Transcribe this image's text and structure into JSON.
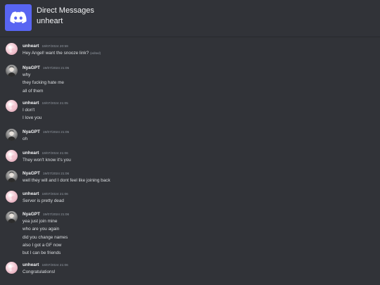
{
  "header": {
    "title": "Direct Messages",
    "subtitle": "unheart",
    "logo_icon": "discord-logo-icon",
    "logo_color": "#5865f2"
  },
  "messages": [
    {
      "author": "unheart",
      "timestamp": "19/07/2024 20:59",
      "avatar": "pink",
      "lines": [
        "Hey Angel! want the snooze link?"
      ],
      "edited_label": "(edited)"
    },
    {
      "author": "NyaGPT",
      "timestamp": "19/07/2024 21:05",
      "avatar": "gray",
      "lines": [
        "why",
        "they fucking hate me",
        "all of them"
      ]
    },
    {
      "author": "unheart",
      "timestamp": "19/07/2024 21:05",
      "avatar": "pink",
      "lines": [
        "I don't",
        "I love you"
      ]
    },
    {
      "author": "NyaGPT",
      "timestamp": "19/07/2024 21:05",
      "avatar": "gray",
      "lines": [
        "oh"
      ]
    },
    {
      "author": "unheart",
      "timestamp": "19/07/2024 21:06",
      "avatar": "pink",
      "lines": [
        "They won't know it's you"
      ]
    },
    {
      "author": "NyaGPT",
      "timestamp": "19/07/2024 21:06",
      "avatar": "gray",
      "lines": [
        "well they will and I dont feel like joining back"
      ]
    },
    {
      "author": "unheart",
      "timestamp": "19/07/2024 21:06",
      "avatar": "pink",
      "lines": [
        "Server is pretty dead"
      ]
    },
    {
      "author": "NyaGPT",
      "timestamp": "19/07/2024 21:06",
      "avatar": "gray",
      "lines": [
        "yea just join mine",
        "who are you again",
        "did you change names",
        "also I got a GF now",
        "but I can be friends"
      ]
    },
    {
      "author": "unheart",
      "timestamp": "19/07/2024 21:06",
      "avatar": "pink",
      "lines": [
        "Congratulations!"
      ]
    }
  ]
}
